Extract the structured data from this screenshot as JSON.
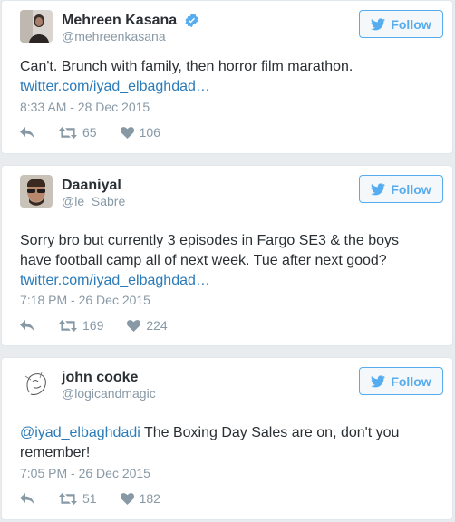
{
  "colors": {
    "accent": "#55acee",
    "link": "#2b7bb9",
    "muted": "#8899a6",
    "text": "#292f33",
    "background": "#e9ecef"
  },
  "tweets": [
    {
      "display_name": "Mehreen Kasana",
      "verified": true,
      "handle": "@mehreenkasana",
      "follow_label": "Follow",
      "text": "Can't. Brunch with family, then horror film marathon.",
      "link": "twitter.com/iyad_elbaghdad…",
      "timestamp": "8:33 AM - 28 Dec 2015",
      "retweets": "65",
      "likes": "106",
      "avatar_icon": "avatar-photo-woman"
    },
    {
      "display_name": "Daaniyal",
      "verified": false,
      "handle": "@le_Sabre",
      "follow_label": "Follow",
      "text": "Sorry bro but currently 3 episodes in Fargo SE3 & the boys have football camp all of next week. Tue after next good?",
      "link": "twitter.com/iyad_elbaghdad…",
      "timestamp": "7:18 PM - 26 Dec 2015",
      "retweets": "169",
      "likes": "224",
      "avatar_icon": "avatar-photo-man-sunglasses"
    },
    {
      "display_name": "john cooke",
      "verified": false,
      "handle": "@logicandmagic",
      "follow_label": "Follow",
      "mention": "@iyad_elbaghdadi",
      "text": " The Boxing Day Sales are on, don't you remember!",
      "timestamp": "7:05 PM - 26 Dec 2015",
      "retweets": "51",
      "likes": "182",
      "avatar_icon": "avatar-line-drawing"
    }
  ]
}
